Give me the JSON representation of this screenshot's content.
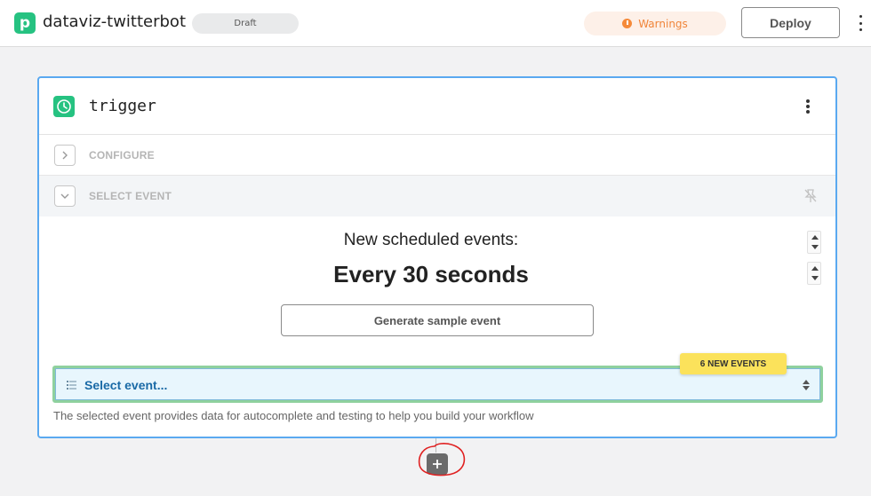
{
  "header": {
    "logo_letter": "p",
    "app_title": "dataviz-twitterbot",
    "status_badge": "Draft",
    "warnings_label": "Warnings",
    "deploy_label": "Deploy"
  },
  "step": {
    "title": "trigger",
    "sections": {
      "configure": "CONFIGURE",
      "select_event": "SELECT EVENT"
    },
    "schedule_label": "New scheduled events:",
    "schedule_value": "Every 30 seconds",
    "generate_button": "Generate sample event",
    "new_events_badge": "6 NEW EVENTS",
    "select_placeholder": "Select event...",
    "helper_text": "The selected event provides data for autocomplete and testing to help you build your workflow"
  },
  "colors": {
    "brand": "#26c281",
    "accent_border": "#5aa9f0",
    "warning": "#f0853a",
    "badge": "#fbe25b",
    "select_text": "#1a6aa6"
  },
  "icons": {
    "logo": "pipedream-logo-icon",
    "warning": "warning-icon",
    "trigger": "clock-icon",
    "unpin": "unpin-icon",
    "add": "plus-icon"
  }
}
